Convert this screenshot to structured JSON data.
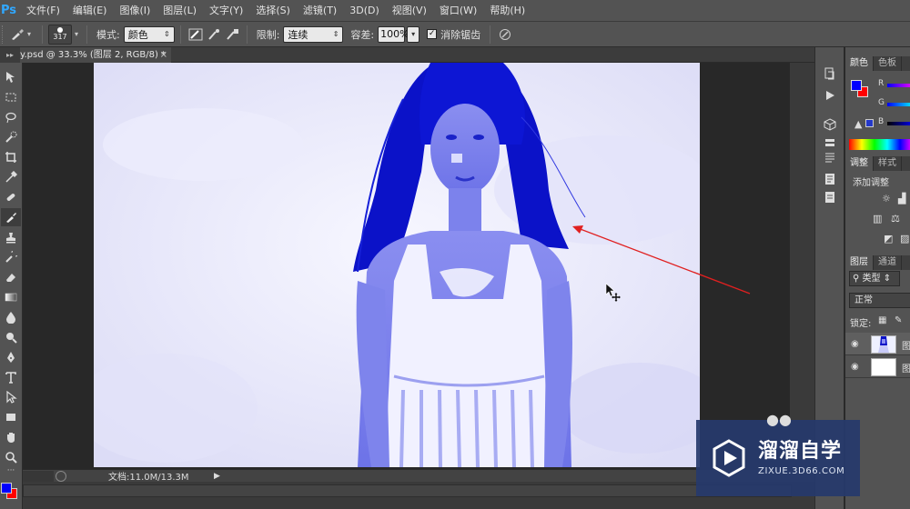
{
  "app": {
    "logo": "Ps"
  },
  "menu": [
    "文件(F)",
    "编辑(E)",
    "图像(I)",
    "图层(L)",
    "文字(Y)",
    "选择(S)",
    "滤镜(T)",
    "3D(D)",
    "视图(V)",
    "窗口(W)",
    "帮助(H)"
  ],
  "options": {
    "brush_size": "317",
    "mode_label": "模式:",
    "mode_value": "颜色",
    "limit_label": "限制:",
    "limit_value": "连续",
    "tolerance_label": "容差:",
    "tolerance_value": "100%",
    "antialias_label": "消除锯齿",
    "antialias_checked": true
  },
  "document": {
    "tab_title": "y.psd @ 33.3% (图层 2, RGB/8) *",
    "close": "×",
    "status_doc": "文档:11.0M/13.3M"
  },
  "panels": {
    "color": {
      "tab1": "颜色",
      "tab2": "色板",
      "r": "R",
      "g": "G",
      "b": "B",
      "fg_color": "#0000ff",
      "bg_color": "#ff0000"
    },
    "adjust": {
      "tab1": "调整",
      "tab2": "样式",
      "add_label": "添加调整"
    },
    "layers": {
      "tab1": "图层",
      "tab2": "通道",
      "filter": "类型",
      "blend": "正常",
      "lock_label": "锁定:",
      "rows": [
        {
          "name": "图",
          "selected": true
        },
        {
          "name": "图",
          "selected": false
        }
      ]
    }
  },
  "colors": {
    "tool_fg": "#0000ff",
    "tool_bg": "#ff0000",
    "annotation_arrow": "#e02020"
  },
  "watermark": {
    "title": "溜溜自学",
    "url": "ZIXUE.3D66.COM"
  }
}
